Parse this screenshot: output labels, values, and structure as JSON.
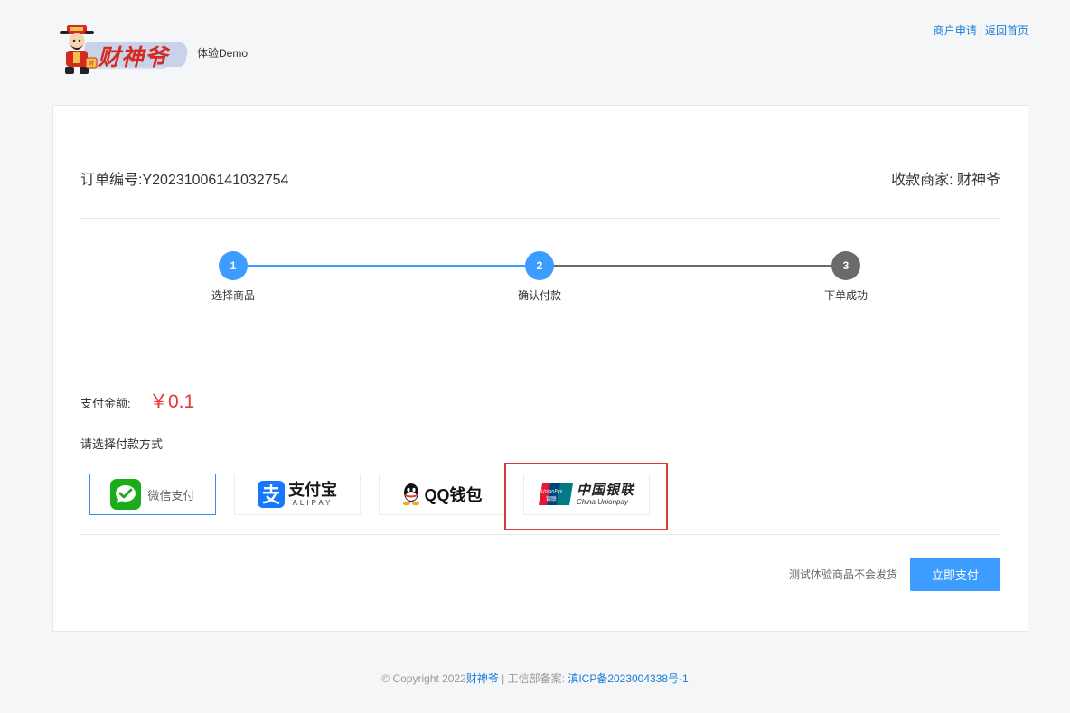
{
  "header": {
    "logo_text": "财神爷",
    "demo_label": "体验Demo",
    "links": {
      "merchant_apply": "商户申请",
      "separator": "|",
      "home": "返回首页"
    }
  },
  "order": {
    "order_no": "订单编号:Y20231006141032754",
    "merchant": "收款商家: 财神爷"
  },
  "steps": [
    {
      "num": "1",
      "label": "选择商品",
      "state": "done"
    },
    {
      "num": "2",
      "label": "确认付款",
      "state": "active"
    },
    {
      "num": "3",
      "label": "下单成功",
      "state": "pending"
    }
  ],
  "payment": {
    "amount_label": "支付金额:",
    "amount": "￥0.1",
    "choose_label": "请选择付款方式",
    "methods": [
      {
        "name": "微信支付",
        "icon": "wechat-pay-icon",
        "selected": true
      },
      {
        "name": "支付宝",
        "sub": "ALIPAY",
        "icon": "alipay-icon",
        "selected": false
      },
      {
        "name": "QQ钱包",
        "icon": "qq-wallet-icon",
        "selected": false
      },
      {
        "name": "中国银联",
        "sub": "China Unionpay",
        "badge": "UnionPay 银联",
        "icon": "unionpay-icon",
        "selected": false,
        "highlighted": true
      }
    ]
  },
  "actions": {
    "notice": "测试体验商品不会发货",
    "pay_button": "立即支付"
  },
  "footer": {
    "copyright": "© Copyright 2022",
    "brand": "财神爷",
    "separator": " | 工信部备案: ",
    "icp": "滇ICP备2023004338号-1"
  },
  "colors": {
    "accent": "#3c9cff",
    "step_done": "#3c9cff",
    "step_pending": "#6b6b6b",
    "amount": "#e53935",
    "highlight": "#d93a3a",
    "wechat": "#1aad19",
    "alipay": "#1677ff"
  }
}
